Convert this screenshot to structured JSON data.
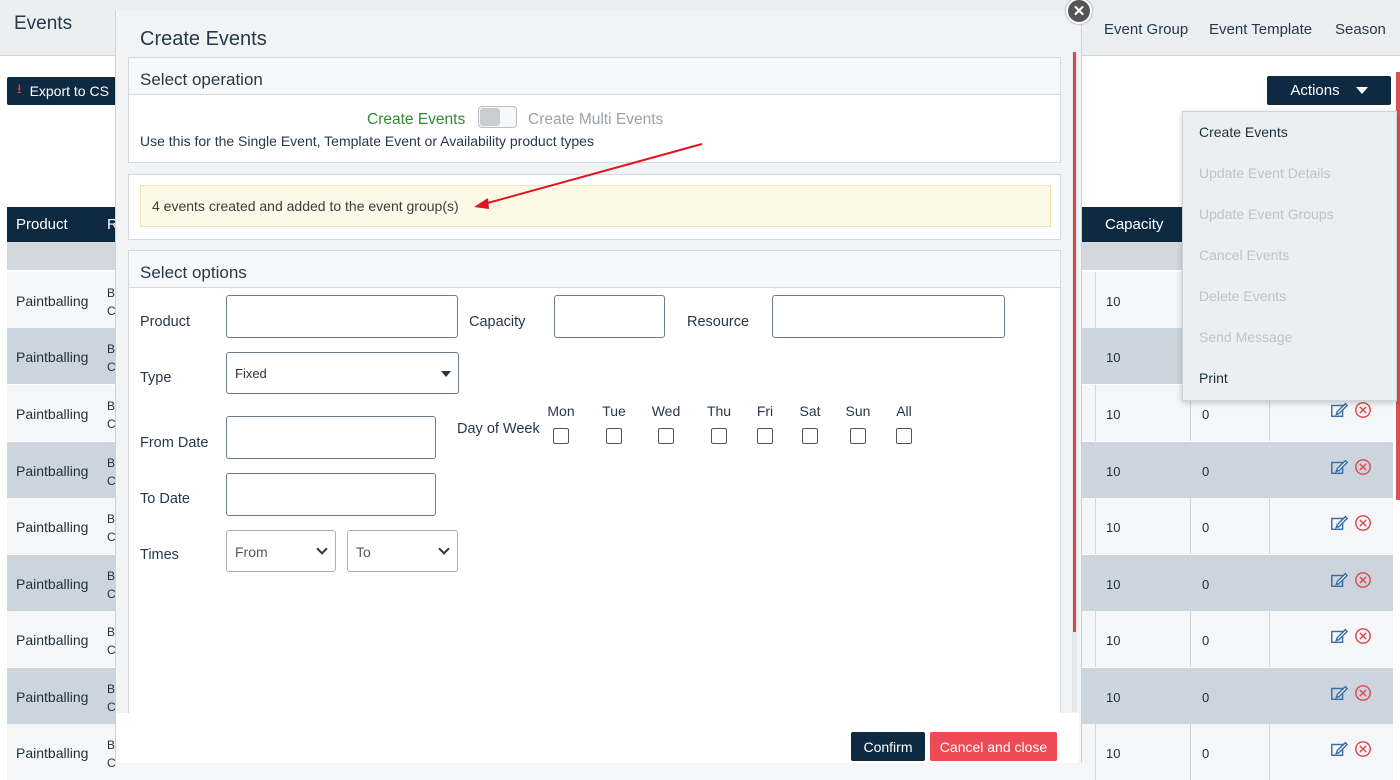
{
  "page": {
    "title": "Events",
    "nav": [
      "Event Group",
      "Event Template",
      "Season"
    ],
    "export_label": "Export to CS",
    "actions_label": "Actions"
  },
  "table": {
    "headers": [
      "Product",
      "R",
      "Capacity"
    ],
    "rows": [
      {
        "product": "Paintballing",
        "res": "B\nC",
        "capacity": "10",
        "booked": ""
      },
      {
        "product": "Paintballing",
        "res": "B\nC",
        "capacity": "10",
        "booked": ""
      },
      {
        "product": "Paintballing",
        "res": "B\nC",
        "capacity": "10",
        "booked": "0"
      },
      {
        "product": "Paintballing",
        "res": "B\nC",
        "capacity": "10",
        "booked": "0"
      },
      {
        "product": "Paintballing",
        "res": "B\nC",
        "capacity": "10",
        "booked": "0"
      },
      {
        "product": "Paintballing",
        "res": "B\nC",
        "capacity": "10",
        "booked": "0"
      },
      {
        "product": "Paintballing",
        "res": "B\nC",
        "capacity": "10",
        "booked": "0"
      },
      {
        "product": "Paintballing",
        "res": "B\nC",
        "capacity": "10",
        "booked": "0"
      },
      {
        "product": "Paintballing",
        "res": "B\nC",
        "capacity": "10",
        "booked": "0"
      }
    ]
  },
  "actions_menu": {
    "items": [
      {
        "label": "Create Events",
        "enabled": true
      },
      {
        "label": "Update Event Details",
        "enabled": false
      },
      {
        "label": "Update Event Groups",
        "enabled": false
      },
      {
        "label": "Cancel Events",
        "enabled": false
      },
      {
        "label": "Delete Events",
        "enabled": false
      },
      {
        "label": "Send Message",
        "enabled": false
      },
      {
        "label": "Print",
        "enabled": true
      }
    ]
  },
  "modal": {
    "title": "Create Events",
    "close_icon": "close-icon",
    "operation": {
      "heading": "Select operation",
      "create_label": "Create Events",
      "multi_label": "Create Multi Events",
      "help_text": "Use this for the Single Event, Template Event or Availability product types"
    },
    "alert_text": "4 events created and added to the event group(s)",
    "options": {
      "heading": "Select options",
      "product_label": "Product",
      "capacity_label": "Capacity",
      "resource_label": "Resource",
      "type_label": "Type",
      "type_value": "Fixed",
      "from_date_label": "From Date",
      "to_date_label": "To Date",
      "day_of_week_label": "Day of Week",
      "days": [
        "Mon",
        "Tue",
        "Wed",
        "Thu",
        "Fri",
        "Sat",
        "Sun",
        "All"
      ],
      "times_label": "Times",
      "from_value": "From",
      "to_value": "To"
    },
    "confirm_label": "Confirm",
    "cancel_label": "Cancel and close"
  },
  "colors": {
    "navy": "#0e2a43",
    "danger": "#ed4a55",
    "success": "#2e8b2e",
    "alert_bg": "#fdf9e6",
    "annotation_arrow": "#e0141e"
  }
}
